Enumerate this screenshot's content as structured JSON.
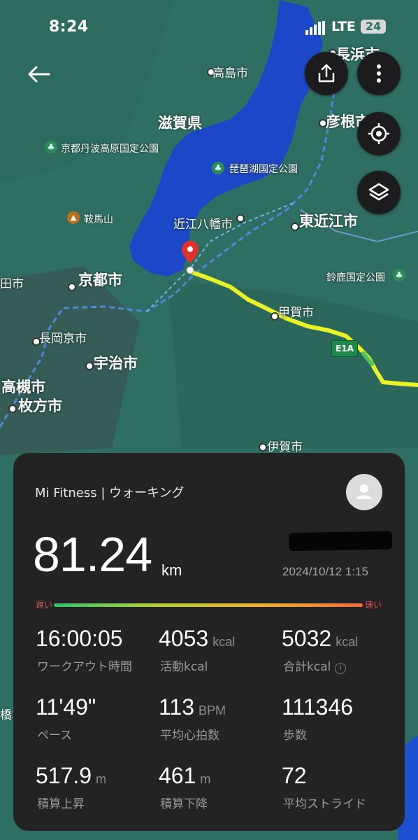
{
  "status_bar": {
    "time": "8:24",
    "network": "LTE",
    "battery": "24"
  },
  "map": {
    "labels": {
      "nagahama": "長浜市",
      "takashima": "高島市",
      "shiga": "滋賀県",
      "hikone": "彦根市",
      "tanba_park": "京都丹波高原国定公園",
      "biwako_park": "琵琶湖国定公園",
      "kurama": "鞍馬山",
      "omihachiman": "近江八幡市",
      "higashiomi": "東近江市",
      "suzuka_park": "鈴鹿国定公園",
      "kyoto": "京都市",
      "koka": "甲賀市",
      "nagaokakyo": "長岡京市",
      "uji": "宇治市",
      "takatsuki": "高槻市",
      "hirakata": "枚方市",
      "iga": "伊賀市",
      "edge_left": "田市",
      "edge_left2": "橋本",
      "highway": "E1A"
    },
    "route_colors": {
      "main": "#e8f226",
      "fast_segment": "#4cc45a"
    }
  },
  "card": {
    "source": "Mi Fitness | ウォーキング",
    "distance": "81.24",
    "distance_unit": "km",
    "datetime": "2024/10/12 1:15",
    "pace_scale": {
      "slow": "遅い",
      "fast": "速い"
    },
    "stats": [
      {
        "value": "16:00:05",
        "unit": "",
        "label": "ワークアウト時間"
      },
      {
        "value": "4053",
        "unit": "kcal",
        "label": "活動kcal"
      },
      {
        "value": "5032",
        "unit": "kcal",
        "label": "合計kcal"
      },
      {
        "value": "11'49\"",
        "unit": "",
        "label": "ペース"
      },
      {
        "value": "113",
        "unit": "BPM",
        "label": "平均心拍数"
      },
      {
        "value": "111346",
        "unit": "",
        "label": "歩数"
      },
      {
        "value": "517.9",
        "unit": "m",
        "label": "積算上昇"
      },
      {
        "value": "461",
        "unit": "m",
        "label": "積算下降"
      },
      {
        "value": "72",
        "unit": "",
        "label": "平均ストライド"
      }
    ]
  }
}
